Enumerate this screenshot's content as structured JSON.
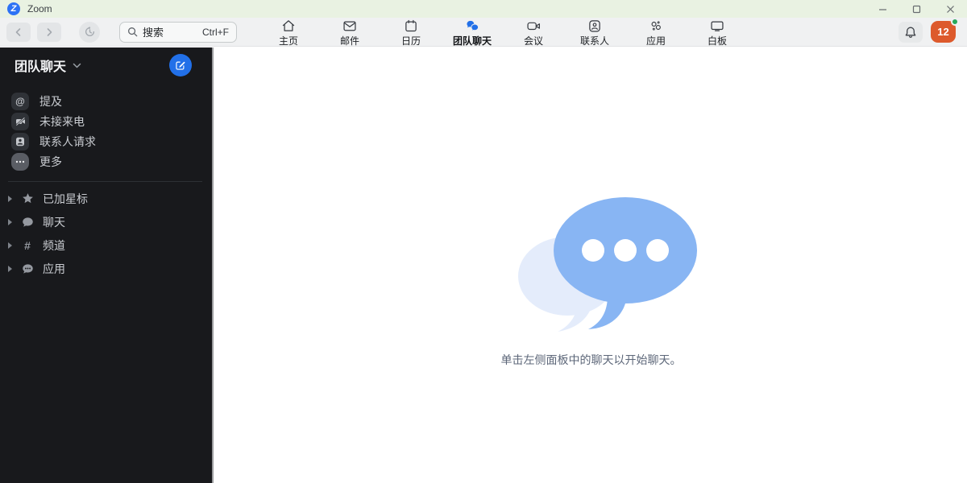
{
  "colors": {
    "accent_blue": "#2270e8",
    "titlebar_green": "#e9f2e2",
    "toolbar_gray": "#f0f1f2",
    "sidebar_dark": "#18191c",
    "avatar_orange": "#dd5a2c",
    "presence_green": "#26a95a",
    "bubble_blue": "#88b5f3",
    "bubble_light": "#e4ecfb"
  },
  "titlebar": {
    "app_title": "Zoom"
  },
  "toolbar": {
    "search": {
      "label": "搜索",
      "shortcut": "Ctrl+F"
    },
    "tabs": [
      {
        "label": "主页",
        "icon": "home-icon",
        "active": false
      },
      {
        "label": "邮件",
        "icon": "mail-icon",
        "active": false
      },
      {
        "label": "日历",
        "icon": "calendar-icon",
        "active": false
      },
      {
        "label": "团队聊天",
        "icon": "team-chat-icon",
        "active": true
      },
      {
        "label": "会议",
        "icon": "meetings-icon",
        "active": false
      },
      {
        "label": "联系人",
        "icon": "contacts-icon",
        "active": false
      },
      {
        "label": "应用",
        "icon": "apps-icon",
        "active": false
      },
      {
        "label": "白板",
        "icon": "whiteboard-icon",
        "active": false
      }
    ],
    "avatar": {
      "badge": "12"
    }
  },
  "sidebar": {
    "title": "团队聊天",
    "quick_items": [
      {
        "label": "提及",
        "icon": "mention-icon"
      },
      {
        "label": "未接来电",
        "icon": "missed-call-icon"
      },
      {
        "label": "联系人请求",
        "icon": "contact-request-icon"
      },
      {
        "label": "更多",
        "icon": "more-icon"
      }
    ],
    "sections": [
      {
        "label": "已加星标",
        "icon": "star-icon"
      },
      {
        "label": "聊天",
        "icon": "chat-icon"
      },
      {
        "label": "频道",
        "icon": "channel-icon"
      },
      {
        "label": "应用",
        "icon": "apps-bubble-icon"
      }
    ]
  },
  "main": {
    "empty_hint": "单击左侧面板中的聊天以开始聊天。"
  }
}
